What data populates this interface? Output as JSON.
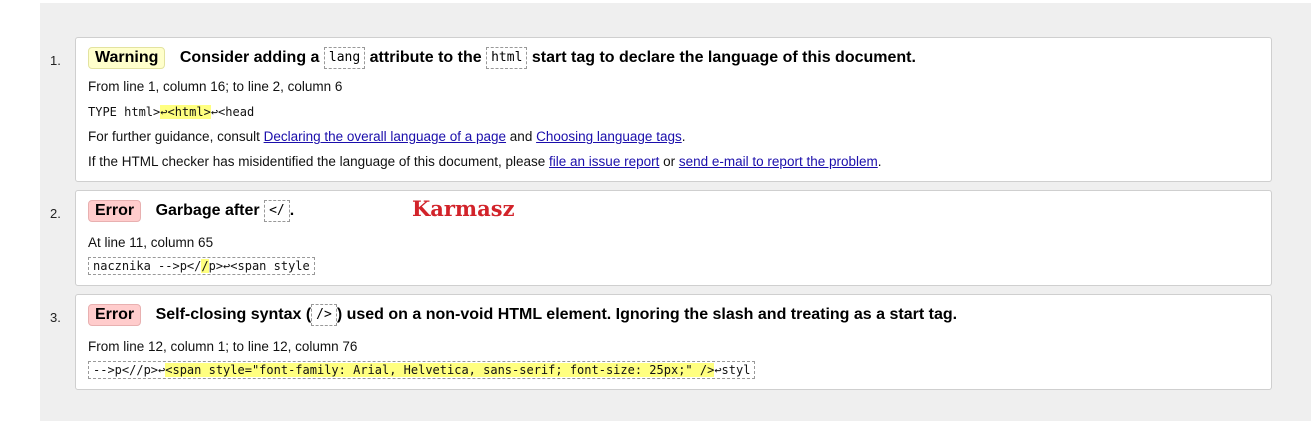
{
  "messages": [
    {
      "number": "1.",
      "badge": "Warning",
      "title_parts": [
        "Consider adding a",
        "lang",
        "attribute to the",
        "html",
        "start tag to declare the language of this document."
      ],
      "location": "From line 1, column 16; to line 2, column 6",
      "extract": {
        "before": "TYPE html>",
        "mark": "↩<html>",
        "after": "↩<head"
      },
      "guidance": {
        "prefix": "For further guidance, consult",
        "link1": "Declaring the overall language of a page",
        "and": "and",
        "link2": "Choosing language tags",
        "suffix": "."
      },
      "report": {
        "prefix": "If the HTML checker has misidentified the language of this document, please",
        "link1": "file an issue report",
        "or": "or",
        "link2": "send e-mail to report the problem",
        "suffix": "."
      }
    },
    {
      "number": "2.",
      "badge": "Error",
      "title_parts": [
        "Garbage after",
        "</",
        "."
      ],
      "location": "At line 11, column 65",
      "extract": {
        "before": "nacznika -->p</",
        "mark": "/",
        "after": "p>↩<span style"
      }
    },
    {
      "number": "3.",
      "badge": "Error",
      "title_parts": [
        "Self-closing syntax (",
        "/>",
        ") used on a non-void HTML element. Ignoring the slash and treating as a start tag."
      ],
      "location": "From line 12, column 1; to line 12, column 76",
      "extract": {
        "before": "-->p<//p>↩",
        "mark": "<span style=\"font-family: Arial, Helvetica, sans-serif; font-size: 25px;\" />",
        "after": "↩styl"
      }
    }
  ],
  "overlay_text": "Karmasz"
}
